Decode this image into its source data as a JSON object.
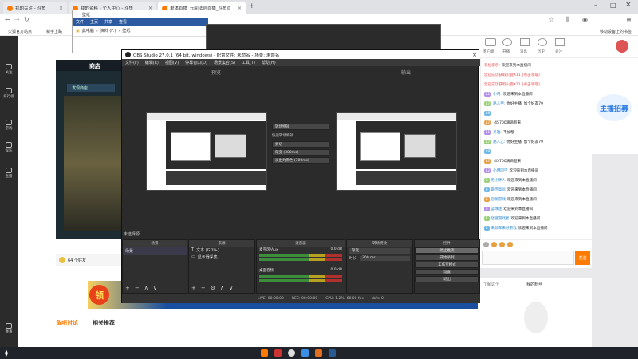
{
  "browser": {
    "tabs": [
      {
        "label": "我的关注 - 斗鱼"
      },
      {
        "label": "我的资料 - 个人中心 - 斗鱼"
      },
      {
        "label": "单体直播_元间法则直播_斗鱼直"
      }
    ],
    "bookmarks": {
      "left1": "火狐官方站点",
      "left2": "新手上路",
      "right": "移动设备上的书签"
    }
  },
  "explorer": {
    "title": "壁纸",
    "ribbon": [
      "文件",
      "主页",
      "共享",
      "查看"
    ],
    "path": [
      "此电脑",
      "资料 (F:)",
      "壁纸"
    ]
  },
  "obs": {
    "title": "OBS Studio 27.0.1 (64 bit, windows) - 配置文件: 未命名 - 场景: 未命名",
    "menu": [
      "文件(F)",
      "编辑(E)",
      "视图(V)",
      "停靠窗口(D)",
      "场景集合(S)",
      "工具(T)",
      "帮助(H)"
    ],
    "preview_label": "预览",
    "program_label": "输出",
    "transitions": {
      "label": "转场特效",
      "quick": "快速转场特效",
      "cut": "剪切",
      "fade_300": "渐变 (300ms)",
      "slide_300": "淡出为黑色 (300ms)"
    },
    "docks": {
      "scenes": {
        "title": "场景",
        "items": [
          "场景"
        ]
      },
      "sources": {
        "title": "来源",
        "items": [
          "文本 (GDI+)",
          "显示器采集"
        ]
      },
      "mixer": {
        "title": "混音器",
        "tracks": [
          {
            "name": "麦克风/Aux",
            "db": "0.0 dB"
          },
          {
            "name": "桌面音频",
            "db": "0.0 dB"
          }
        ]
      },
      "transitions": {
        "title": "转场特效",
        "fade": "渐变",
        "duration_label": "时长",
        "duration_value": "300 ms"
      },
      "controls": {
        "title": "控件",
        "buttons": [
          "停止推流",
          "开始录制",
          "工作室模式",
          "设置",
          "退出"
        ]
      }
    },
    "status": {
      "live": "LIVE: 00:00:00",
      "rec": "REC: 00:00:00",
      "cpu": "CPU: 1.2%, 60.00 fps",
      "kbps": "kb/s: 0"
    },
    "not_selected": "未选择源"
  },
  "douyu": {
    "nav": [
      "关注",
      "排行榜",
      "游戏",
      "娱乐",
      "直播",
      "赛事"
    ],
    "top_nav": [
      "客户端",
      "开播",
      "消息",
      "历史",
      "关注"
    ],
    "store": {
      "title": "商店",
      "subtitle": "发现商店"
    },
    "game": {
      "friends": "64 个好友"
    },
    "chat": [
      {
        "lvl": "",
        "user": "系统提示:",
        "msg": "欢迎来到本直播间",
        "system": true
      },
      {
        "lvl": "",
        "user": "您已成功获取火鹿X11",
        "msg": "[点击领取]",
        "system": true
      },
      {
        "lvl": "",
        "user": "您已成功获取火鹿X11",
        "msg": "[点击领取]",
        "system": true
      },
      {
        "lvl": "12",
        "user": "小明:",
        "msg": "欢迎来到本直播间",
        "system": false
      },
      {
        "lvl": "17",
        "user": "路人甲:",
        "msg": "你好主播, 加个好友79",
        "system": false
      },
      {
        "lvl": "19",
        "user": "",
        "msg": "",
        "system": false
      },
      {
        "lvl": "17",
        "user": "",
        "msg": "45700滴滴超来",
        "system": false
      },
      {
        "lvl": "11",
        "user": "英雄:",
        "msg": "不加粮",
        "system": false
      },
      {
        "lvl": "17",
        "user": "路人乙:",
        "msg": "你好主播, 加个好友79",
        "system": false
      },
      {
        "lvl": "19",
        "user": "",
        "msg": "",
        "system": false
      },
      {
        "lvl": "17",
        "user": "",
        "msg": "45700滴滴超来",
        "system": false
      },
      {
        "lvl": "12",
        "user": "小明同学",
        "msg": "欢迎来到本直播间",
        "system": false
      },
      {
        "lvl": "8",
        "user": "无小胖人",
        "msg": "欢迎来到本直播间",
        "system": false
      },
      {
        "lvl": "9",
        "user": "最佳高远",
        "msg": "欢迎来到本直播间",
        "system": false
      },
      {
        "lvl": "8",
        "user": "迎新游戏",
        "msg": "欢迎来到本直播间",
        "system": false
      },
      {
        "lvl": "6",
        "user": "篮球迷",
        "msg": "欢迎来到本直播间",
        "system": false
      },
      {
        "lvl": "7",
        "user": "怪兽游戏者",
        "msg": "欢迎来到本直播间",
        "system": false
      },
      {
        "lvl": "5",
        "user": "来源车来好游戏",
        "msg": "欢迎来到本直播间",
        "system": false
      }
    ],
    "send": "发送",
    "fans_label": "我的粉丝",
    "fans_left": "了解这个",
    "forum": [
      "鱼吧讨论",
      "相关推荐"
    ],
    "promo_badge": "领",
    "ad": "主播招募"
  },
  "colors": {
    "accent": "#ff7a00",
    "obs_bg": "#2b2b2b",
    "ribbon": "#2c5aa0"
  }
}
